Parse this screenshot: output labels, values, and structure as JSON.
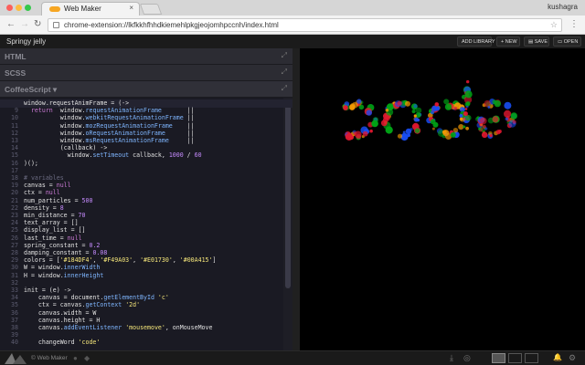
{
  "browser": {
    "tab_title": "Web Maker",
    "tab_close": "×",
    "profile_name": "kushagra",
    "url": "chrome-extension://lkfkkhfhhdkiemehlpkgjeojomhpccnh/index.html",
    "back_glyph": "←",
    "forward_glyph": "→",
    "reload_glyph": "↻",
    "star_glyph": "☆",
    "menu_glyph": "⋮"
  },
  "app": {
    "title": "Springy jelly",
    "buttons": {
      "add_library": "ADD LIBRARY",
      "new": "+ NEW",
      "save": "▤ SAVE",
      "open": "▭ OPEN"
    },
    "panels": {
      "html": "HTML",
      "scss": "SCSS",
      "coffee": "CoffeeScript ▾",
      "expand": "⤢"
    },
    "footer": {
      "brand": "© Web Maker",
      "download_glyph": "⤓",
      "help_glyph": "◎",
      "bell_glyph": "🔔",
      "settings_glyph": "⚙"
    }
  },
  "code_lines": [
    {
      "n": "",
      "t": "window.requestAnimFrame = (->"
    },
    {
      "n": "9",
      "t": "  return  window.requestAnimationFrame       ||"
    },
    {
      "n": "10",
      "t": "          window.webkitRequestAnimationFrame ||"
    },
    {
      "n": "11",
      "t": "          window.mozRequestAnimationFrame    ||"
    },
    {
      "n": "12",
      "t": "          window.oRequestAnimationFrame      ||"
    },
    {
      "n": "13",
      "t": "          window.msRequestAnimationFrame     ||"
    },
    {
      "n": "14",
      "t": "          (callback) ->"
    },
    {
      "n": "15",
      "t": "            window.setTimeout callback, 1000 / 60"
    },
    {
      "n": "16",
      "t": ")();"
    },
    {
      "n": "17",
      "t": ""
    },
    {
      "n": "18",
      "t": "# variables"
    },
    {
      "n": "19",
      "t": "canvas = null"
    },
    {
      "n": "20",
      "t": "ctx = null"
    },
    {
      "n": "21",
      "t": "num_particles = 500"
    },
    {
      "n": "22",
      "t": "density = 8"
    },
    {
      "n": "23",
      "t": "min_distance = 70"
    },
    {
      "n": "24",
      "t": "text_array = []"
    },
    {
      "n": "25",
      "t": "display_list = []"
    },
    {
      "n": "26",
      "t": "last_time = null"
    },
    {
      "n": "27",
      "t": "spring_constant = 0.2"
    },
    {
      "n": "28",
      "t": "damping_constant = 0.08"
    },
    {
      "n": "29",
      "t": "colors = ['#184DF4', '#F49A03', '#E01730', '#00A415']"
    },
    {
      "n": "30",
      "t": "W = window.innerWidth"
    },
    {
      "n": "31",
      "t": "H = window.innerHeight"
    },
    {
      "n": "32",
      "t": ""
    },
    {
      "n": "33",
      "t": "init = (e) ->"
    },
    {
      "n": "34",
      "t": "    canvas = document.getElementById 'c'"
    },
    {
      "n": "35",
      "t": "    ctx = canvas.getContext '2d'"
    },
    {
      "n": "36",
      "t": "    canvas.width = W"
    },
    {
      "n": "37",
      "t": "    canvas.height = H"
    },
    {
      "n": "38",
      "t": "    canvas.addEventListener 'mousemove', onMouseMove"
    },
    {
      "n": "39",
      "t": ""
    },
    {
      "n": "40",
      "t": "    changeWord 'code'"
    }
  ],
  "colors": {
    "particles": [
      "#184DF4",
      "#F49A03",
      "#E01730",
      "#00A415"
    ]
  }
}
